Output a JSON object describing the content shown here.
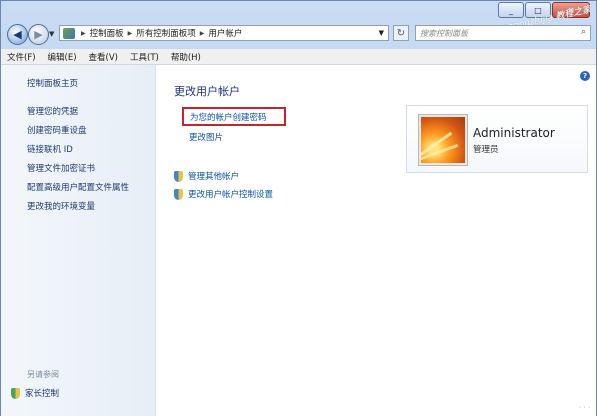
{
  "window": {
    "caption_buttons": [
      "_",
      "□",
      "✕"
    ]
  },
  "nav": {
    "back_glyph": "◀",
    "forward_glyph": "▶",
    "breadcrumbs": [
      "控制面板",
      "所有控制面板项",
      "用户帐户"
    ],
    "search_placeholder": "搜索控制面板",
    "refresh_glyph": "↻",
    "search_glyph": "⌕"
  },
  "menu": [
    "文件(F)",
    "编辑(E)",
    "查看(V)",
    "工具(T)",
    "帮助(H)"
  ],
  "sidebar": {
    "title": "控制面板主页",
    "links": [
      "管理您的凭据",
      "创建密码重设盘",
      "链接联机 ID",
      "管理文件加密证书",
      "配置高级用户配置文件属性",
      "更改我的环境变量"
    ],
    "see_also": "另请参阅",
    "parental_control": "家长控制"
  },
  "main": {
    "title": "更改用户帐户",
    "create_password": "为您的帐户创建密码",
    "change_picture": "更改图片",
    "tasks": [
      "管理其他帐户",
      "更改用户帐户控制设置"
    ],
    "help_glyph": "?"
  },
  "account": {
    "name": "Administrator",
    "type": "管理员"
  },
  "watermark": {
    "top": "jiaochengzhijia 教程之家",
    "bottom": "ᐧ ᐧ ᐧ"
  },
  "icons": {
    "control_panel": "control-panel-icon",
    "uac_shield": "uac-shield-icon",
    "parental_shield": "parental-control-icon",
    "avatar": "user-avatar-flower"
  }
}
